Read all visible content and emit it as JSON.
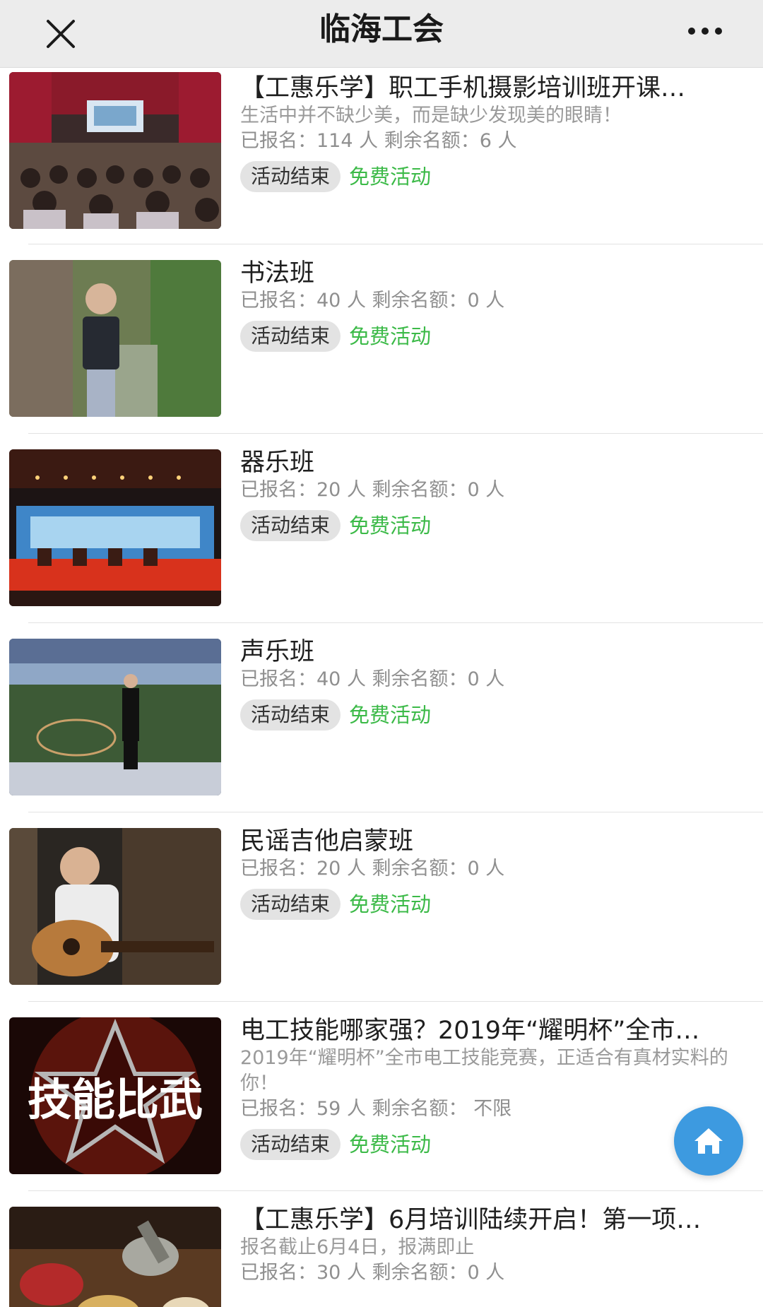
{
  "header": {
    "title": "临海工会",
    "close_icon": "close-icon",
    "more_icon": "more-dots-icon"
  },
  "colors": {
    "free_tag": "#3cba48",
    "ended_tag_bg": "#e3e3e3",
    "home_button": "#3d9ae0"
  },
  "items": [
    {
      "title": "【工惠乐学】职工手机摄影培训班开课…",
      "desc": "生活中并不缺少美，而是缺少发现美的眼睛！",
      "stats": "已报名：114 人 剩余名额：6 人",
      "status": "活动结束",
      "fee": "免费活动"
    },
    {
      "title": "书法班",
      "desc": "",
      "stats": "已报名：40 人 剩余名额：0 人",
      "status": "活动结束",
      "fee": "免费活动"
    },
    {
      "title": "器乐班",
      "desc": "",
      "stats": "已报名：20 人 剩余名额：0 人",
      "status": "活动结束",
      "fee": "免费活动"
    },
    {
      "title": "声乐班",
      "desc": "",
      "stats": "已报名：40 人 剩余名额：0 人",
      "status": "活动结束",
      "fee": "免费活动"
    },
    {
      "title": "民谣吉他启蒙班",
      "desc": "",
      "stats": "已报名：20 人 剩余名额：0 人",
      "status": "活动结束",
      "fee": "免费活动"
    },
    {
      "title": "电工技能哪家强？2019年“耀明杯”全市…",
      "desc": "2019年“耀明杯”全市电工技能竞赛，正适合有真材实料的你！",
      "stats": "已报名：59 人 剩余名额： 不限",
      "status": "活动结束",
      "fee": "免费活动",
      "thumb_text": "技能比武"
    },
    {
      "title": "【工惠乐学】6月培训陆续开启！第一项…",
      "desc": "报名截止6月4日，报满即止",
      "stats": "已报名：30 人 剩余名额：0 人",
      "status": "",
      "fee": ""
    }
  ],
  "home_button_icon": "home-icon"
}
